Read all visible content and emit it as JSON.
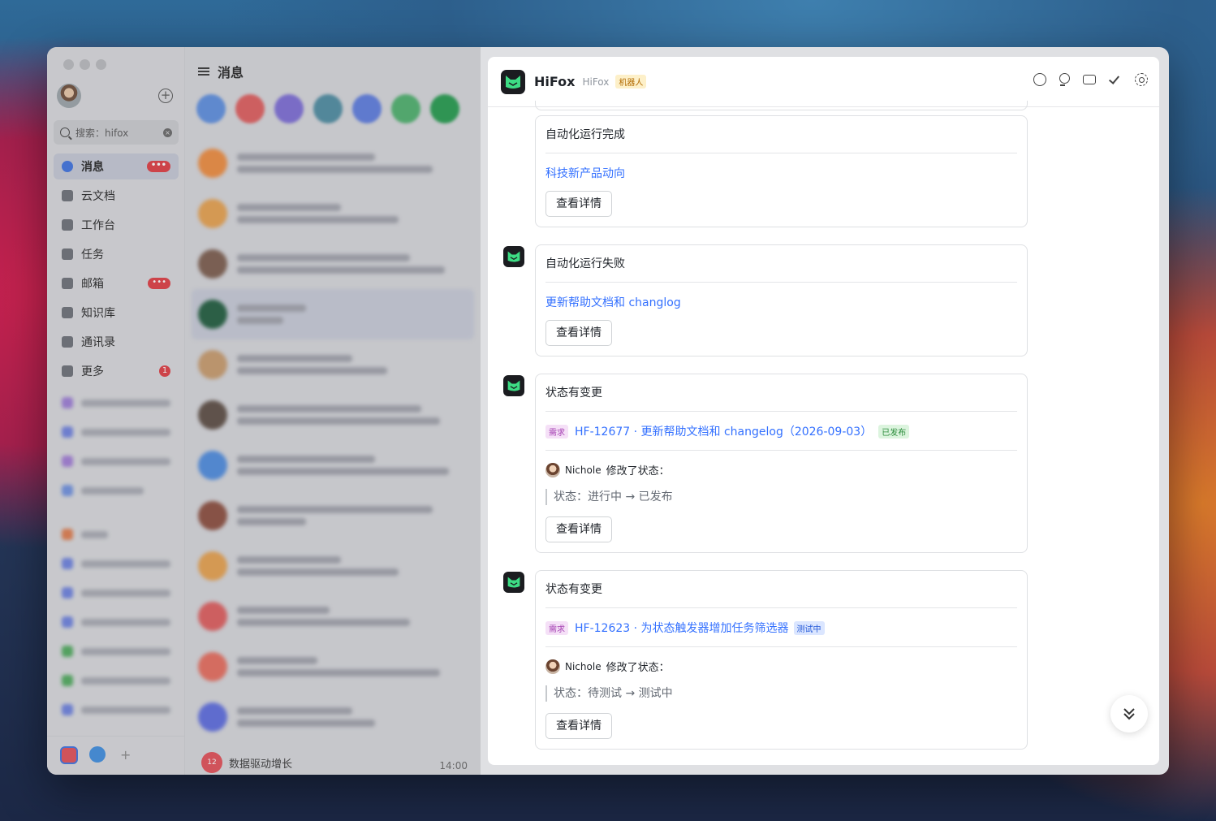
{
  "sidebar": {
    "search_text": "搜索：hifox",
    "nav": [
      {
        "label": "消息",
        "badge": "•••",
        "active": true
      },
      {
        "label": "云文档"
      },
      {
        "label": "工作台"
      },
      {
        "label": "任务"
      },
      {
        "label": "邮箱",
        "badge": "•••"
      },
      {
        "label": "知识库"
      },
      {
        "label": "通讯录"
      },
      {
        "label": "更多",
        "count": "1"
      }
    ]
  },
  "list": {
    "title": "消息",
    "last_item": {
      "badge": "12",
      "name": "数据驱动增长",
      "time": "14:00"
    }
  },
  "chat": {
    "title": "HiFox",
    "subtitle": "HiFox",
    "tag": "机器人",
    "cards": [
      {
        "title": "自动化运行完成",
        "link": "科技新产品动向",
        "button": "查看详情"
      },
      {
        "title": "自动化运行失败",
        "link": "更新帮助文档和 changlog",
        "button": "查看详情"
      },
      {
        "title": "状态有变更",
        "req_tag": "需求",
        "req_text": "HF-12677 · 更新帮助文档和 changelog（2026-09-03）",
        "status_tag": "已发布",
        "user": "Nichole",
        "action": "修改了状态：",
        "change": "状态：进行中 → 已发布",
        "button": "查看详情"
      },
      {
        "title": "状态有变更",
        "req_tag": "需求",
        "req_text": "HF-12623 · 为状态触发器增加任务筛选器",
        "status_tag": "测试中",
        "user": "Nichole",
        "action": "修改了状态：",
        "change": "状态：待测试 → 测试中",
        "button": "查看详情"
      }
    ]
  }
}
